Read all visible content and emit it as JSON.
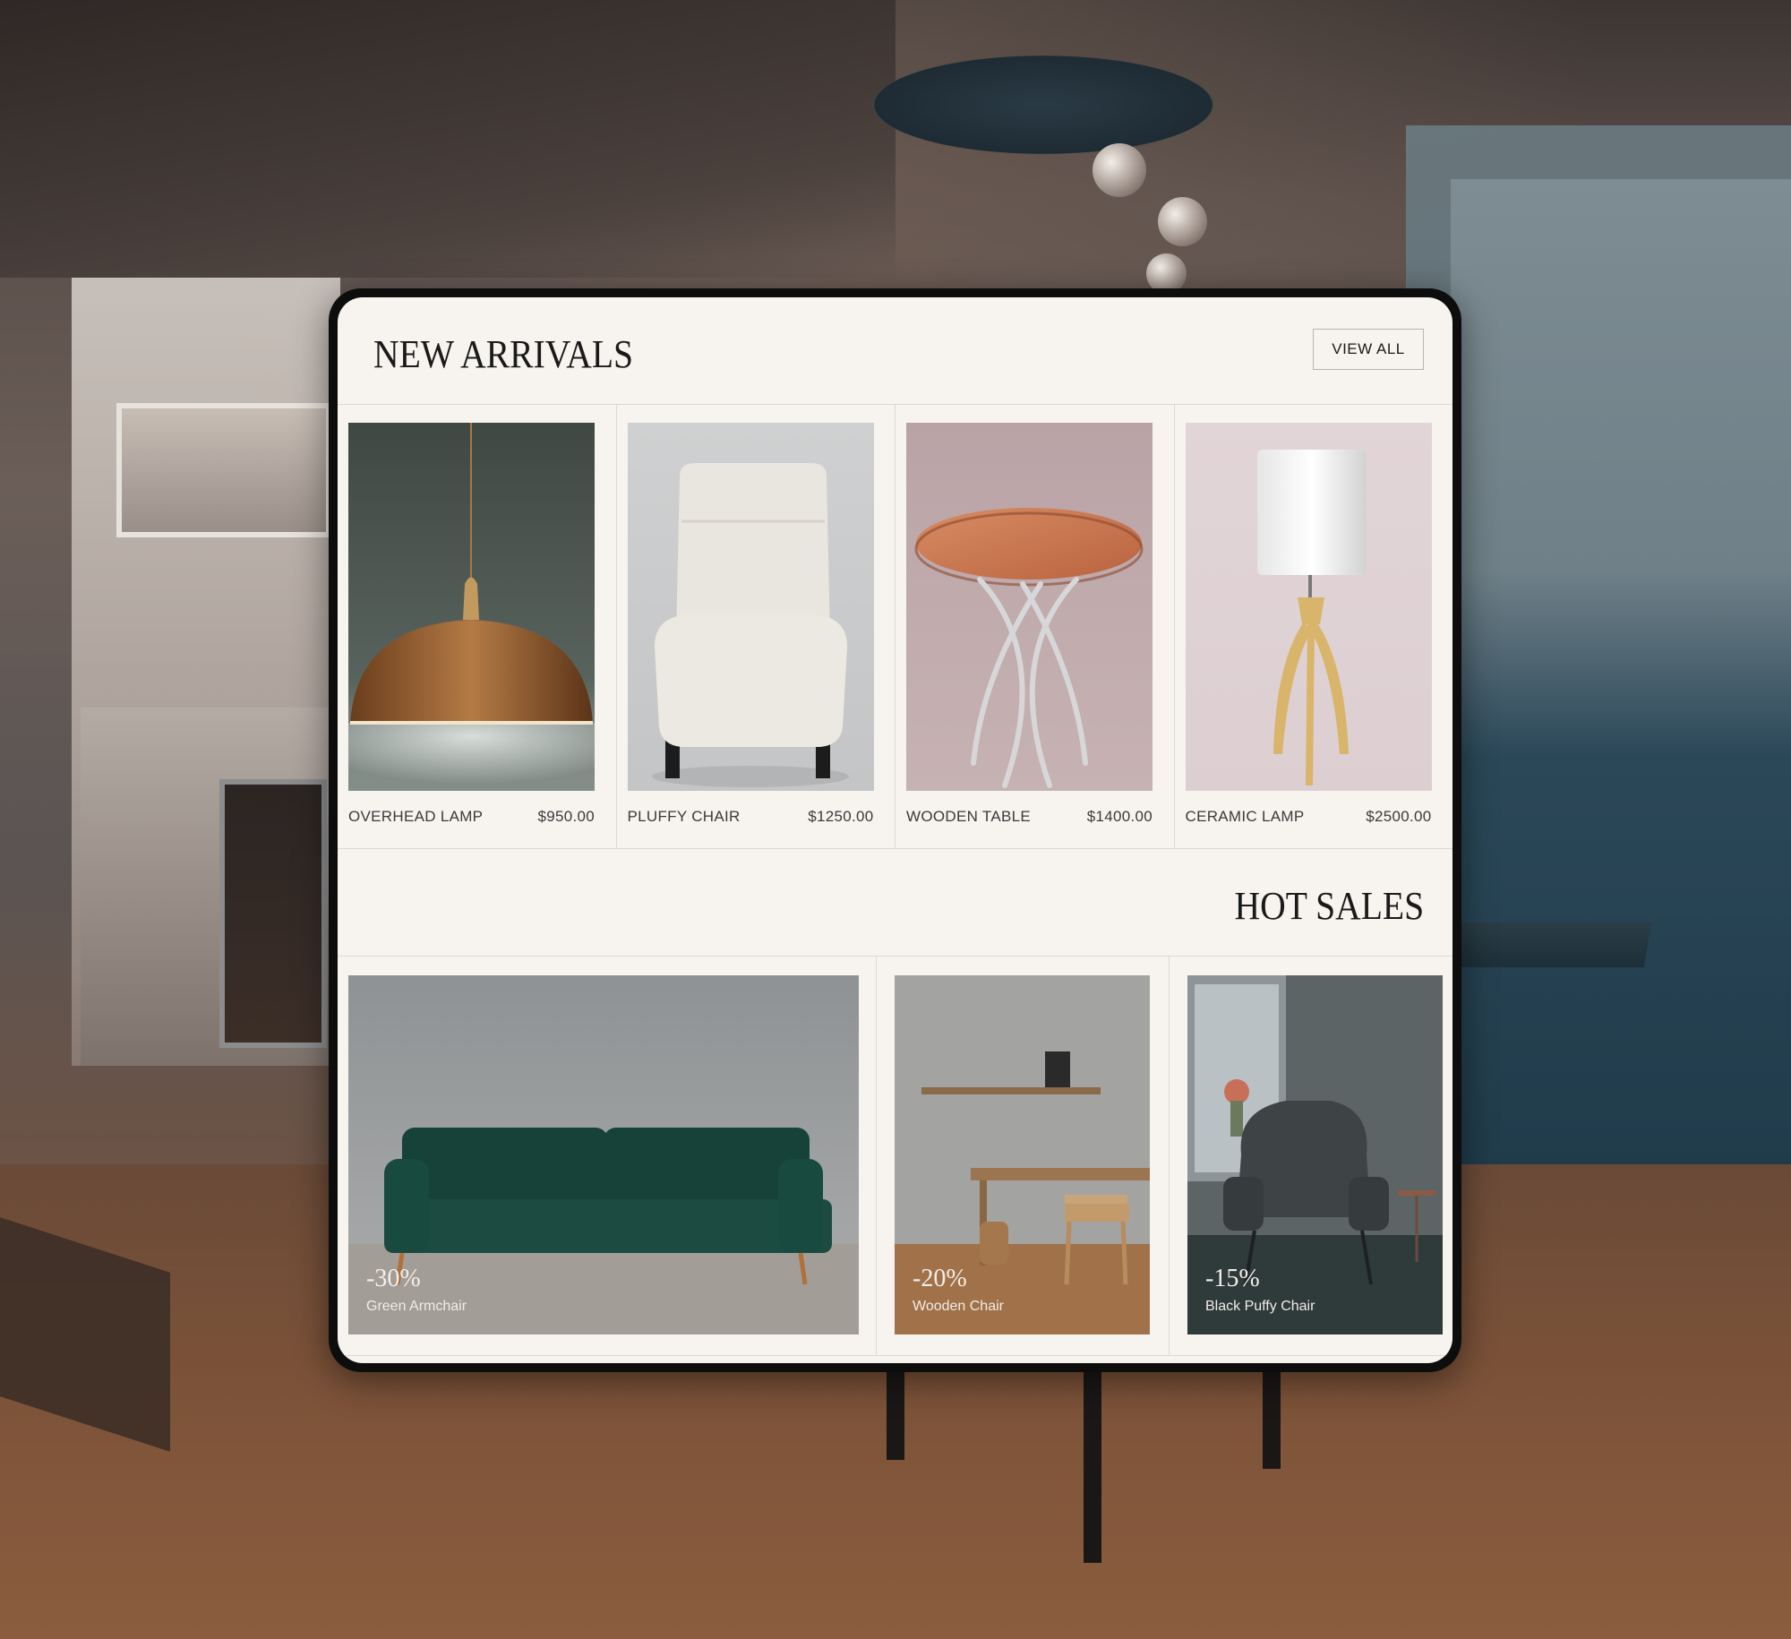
{
  "new_arrivals": {
    "title": "NEW ARRIVALS",
    "view_all_label": "VIEW ALL",
    "products": [
      {
        "name": "OVERHEAD LAMP",
        "price": "$950.00"
      },
      {
        "name": "PLUFFY CHAIR",
        "price": "$1250.00"
      },
      {
        "name": "WOODEN TABLE",
        "price": "$1400.00"
      },
      {
        "name": "CERAMIC LAMP",
        "price": "$2500.00"
      }
    ]
  },
  "hot_sales": {
    "title": "HOT SALES",
    "items": [
      {
        "discount": "-30%",
        "name": "Green Armchair"
      },
      {
        "discount": "-20%",
        "name": "Wooden Chair"
      },
      {
        "discount": "-15%",
        "name": "Black Puffy Chair"
      }
    ]
  },
  "colors": {
    "page_background": "#f7f4f0",
    "text_primary": "#1a1a1a",
    "divider": "#dcd8d2"
  }
}
